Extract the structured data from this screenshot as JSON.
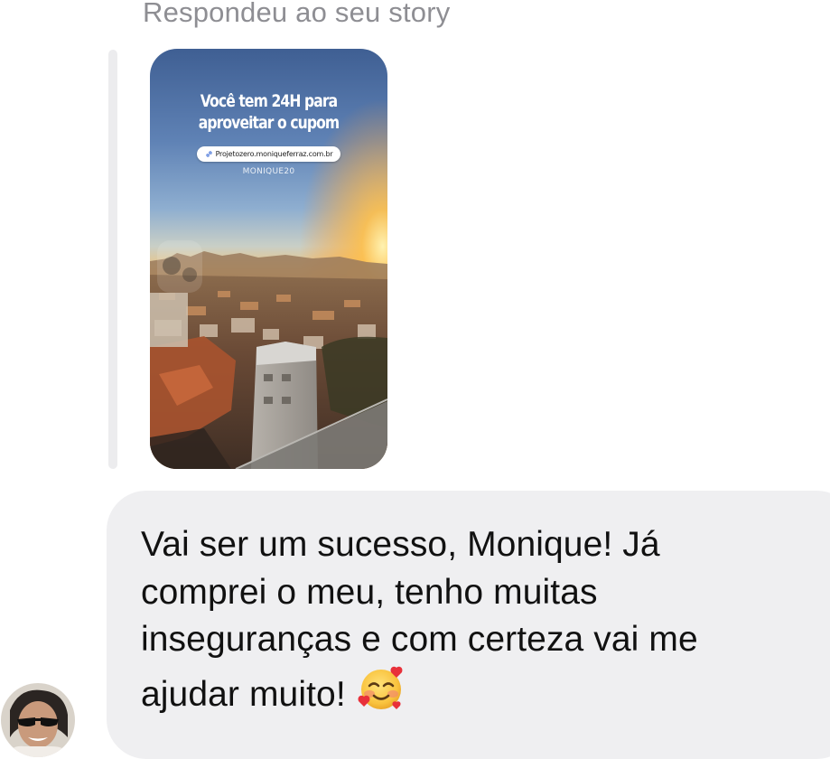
{
  "reply": {
    "caption": "Respondeu ao seu story"
  },
  "story": {
    "headline_line1": "Você tem 24H para",
    "headline_line2": "aproveitar o cupom",
    "link_text": "Projetozero.moniqueferraz.com.br",
    "coupon_code": "MONIQUE20"
  },
  "message": {
    "line1": "Vai ser um sucesso, Monique! Já",
    "line2": "comprei o meu, tenho muitas",
    "line3": "inseguranças e com certeza vai me",
    "line4": "ajudar muito!",
    "emoji": "smiling-face-with-hearts"
  },
  "colors": {
    "caption_gray": "#8e8e93",
    "bubble_bg": "#efeff1",
    "quote_bar": "#ececee",
    "text": "#111111"
  }
}
